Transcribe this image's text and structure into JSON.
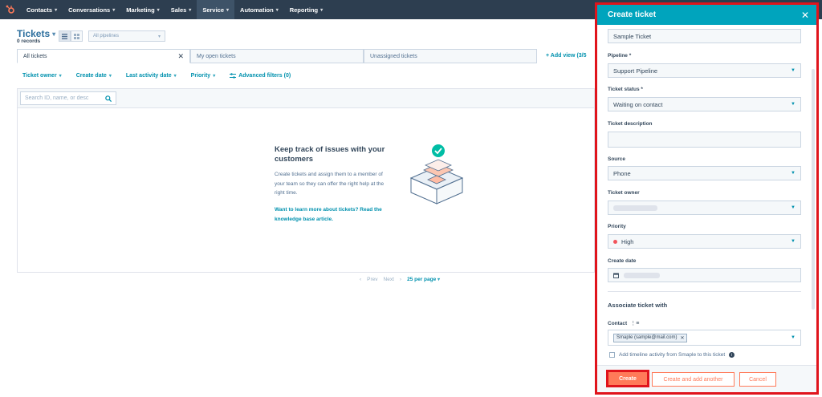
{
  "nav": {
    "items": [
      {
        "label": "Contacts"
      },
      {
        "label": "Conversations"
      },
      {
        "label": "Marketing"
      },
      {
        "label": "Sales"
      },
      {
        "label": "Service"
      },
      {
        "label": "Automation"
      },
      {
        "label": "Reporting"
      }
    ],
    "active_index": 4
  },
  "header": {
    "title": "Tickets",
    "records": "0 records",
    "pipeline_placeholder": "All pipelines"
  },
  "tabs": [
    {
      "label": "All tickets"
    },
    {
      "label": "My open tickets"
    },
    {
      "label": "Unassigned tickets"
    }
  ],
  "add_view": "+ Add view (3/5",
  "filters": [
    {
      "label": "Ticket owner"
    },
    {
      "label": "Create date"
    },
    {
      "label": "Last activity date"
    },
    {
      "label": "Priority"
    },
    {
      "label": "Advanced filters (0)"
    }
  ],
  "search": {
    "placeholder": "Search ID, name, or desc"
  },
  "empty_state": {
    "title": "Keep track of issues with your customers",
    "description": "Create tickets and assign them to a member of your team so they can offer the right help at the right time.",
    "link": "Want to learn more about tickets? Read the knowledge base article."
  },
  "pagination": {
    "prev": "Prev",
    "next": "Next",
    "per_page": "25 per page"
  },
  "drawer": {
    "title": "Create ticket",
    "ticket_name": "Sample Ticket",
    "pipeline_label": "Pipeline *",
    "pipeline_value": "Support Pipeline",
    "status_label": "Ticket status *",
    "status_value": "Waiting on contact",
    "description_label": "Ticket description",
    "source_label": "Source",
    "source_value": "Phone",
    "owner_label": "Ticket owner",
    "priority_label": "Priority",
    "priority_value": "High",
    "create_date_label": "Create date",
    "associate_title": "Associate ticket with",
    "contact_label": "Contact",
    "contact_tag": "Smaple (sample@mail.com)",
    "timeline_text": "Add timeline activity from Smaple to this ticket",
    "buttons": {
      "create": "Create",
      "create_another": "Create and add another",
      "cancel": "Cancel"
    }
  },
  "colors": {
    "nav_bg": "#2d3e50",
    "drawer_header": "#00a4bd",
    "accent_link": "#0091ae",
    "primary_button": "#ff7a59",
    "highlight_border": "#e0141c"
  }
}
